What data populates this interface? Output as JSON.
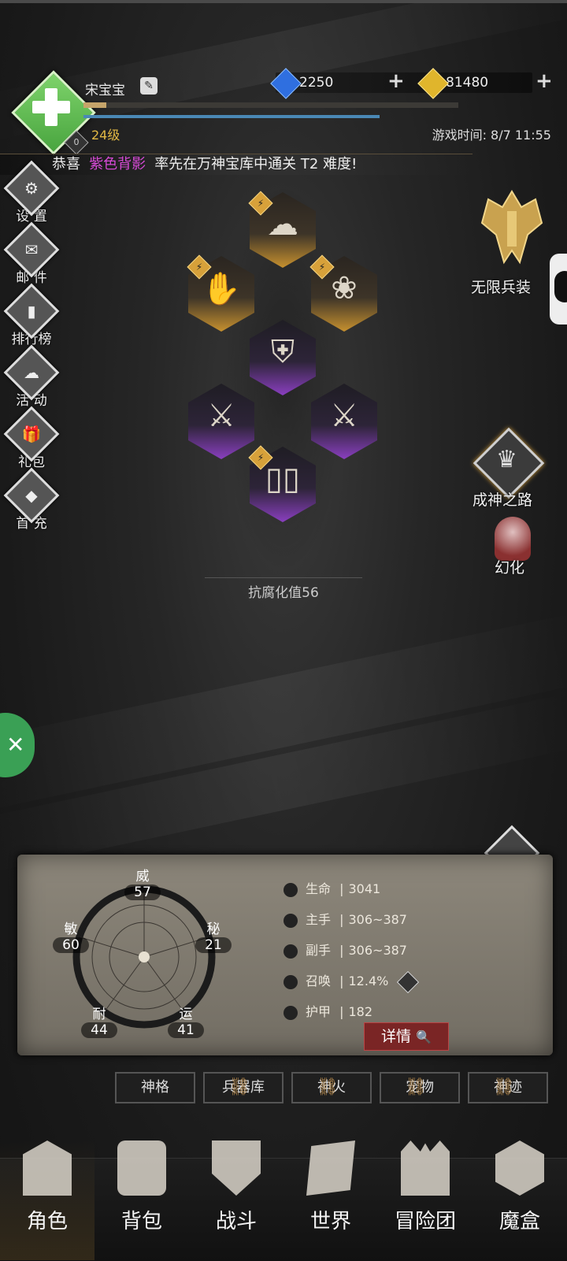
{
  "player": {
    "name": "宋宝宝",
    "level": "24级",
    "vip": "0",
    "exp_fraction": 0.06
  },
  "currency": {
    "diamonds": "2250",
    "gold": "81480"
  },
  "game_time": "游戏时间: 8/7 11:55",
  "announcement": {
    "prefix": "恭喜",
    "player": "紫色背影",
    "suffix": "率先在万神宝库中通关 T2 难度!",
    "highlight_color": "#d64ad6"
  },
  "left_menu": [
    {
      "label": "设 置",
      "icon": "gear-icon"
    },
    {
      "label": "邮 件",
      "icon": "mail-icon"
    },
    {
      "label": "排行榜",
      "icon": "ranking-icon"
    },
    {
      "label": "活 动",
      "icon": "event-icon"
    },
    {
      "label": "礼包",
      "icon": "gift-icon"
    },
    {
      "label": "首 充",
      "icon": "first-recharge-icon"
    }
  ],
  "right_menu": {
    "infinite_weapons": "无限兵装",
    "path_to_godhood": "成神之路",
    "transform": "幻化"
  },
  "equipment": {
    "resist_label": "抗腐化值56",
    "slots": [
      {
        "slot": "helmet",
        "rarity": "gold",
        "icon": "hat-icon"
      },
      {
        "slot": "shoulder",
        "rarity": "gold",
        "icon": "gauntlet-icon"
      },
      {
        "slot": "accessory",
        "rarity": "gold",
        "icon": "necklace-icon"
      },
      {
        "slot": "armor",
        "rarity": "purple",
        "icon": "armor-icon"
      },
      {
        "slot": "main-hand",
        "rarity": "purple",
        "icon": "blade-icon"
      },
      {
        "slot": "off-hand",
        "rarity": "purple",
        "icon": "blade-icon"
      },
      {
        "slot": "boots",
        "rarity": "purple",
        "icon": "boots-icon"
      }
    ]
  },
  "attributes": {
    "wei": {
      "label": "威",
      "value": "57"
    },
    "mi": {
      "label": "秘",
      "value": "21"
    },
    "yun": {
      "label": "运",
      "value": "41"
    },
    "nai": {
      "label": "耐",
      "value": "44"
    },
    "min": {
      "label": "敏",
      "value": "60"
    }
  },
  "stats": [
    {
      "label": "生命",
      "value": "3041"
    },
    {
      "label": "主手",
      "value": "306~387"
    },
    {
      "label": "副手",
      "value": "306~387"
    },
    {
      "label": "召唤",
      "value": "12.4%"
    },
    {
      "label": "护甲",
      "value": "182"
    }
  ],
  "detail_button": "详情",
  "tabs": [
    "神格",
    "兵器库",
    "神火",
    "宠物",
    "神迹"
  ],
  "bottom_nav": [
    "角色",
    "背包",
    "战斗",
    "世界",
    "冒险团",
    "魔盒"
  ]
}
